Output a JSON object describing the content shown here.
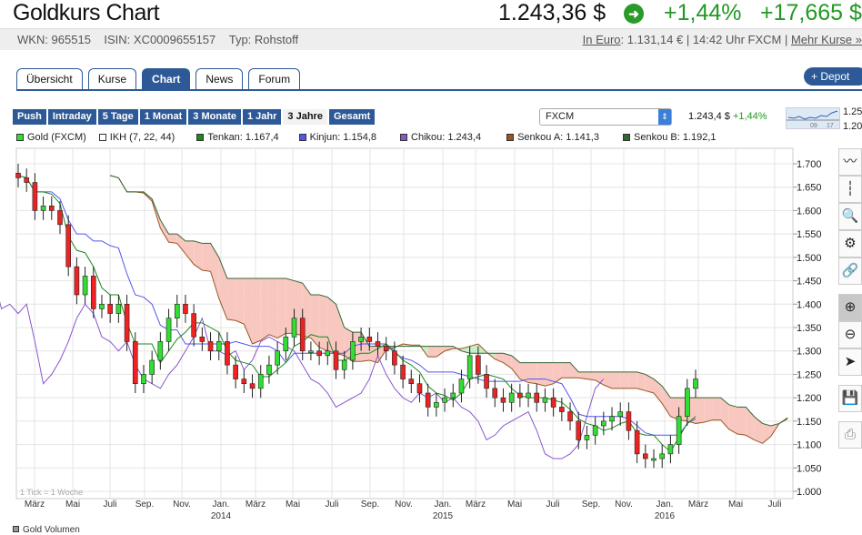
{
  "header": {
    "title": "Goldkurs Chart",
    "price": "1.243,36 $",
    "change_pct": "+1,44%",
    "change_abs": "+17,665 $",
    "trend_icon": "arrow-up-circle-icon"
  },
  "info": {
    "wkn": "WKN: 965515",
    "isin": "ISIN: XC0009655157",
    "typ": "Typ: Rohstoff",
    "euro_label": "In Euro",
    "euro_rest": ": 1.131,14 € | 14:42 Uhr FXCM | ",
    "more": "Mehr Kurse »"
  },
  "tabs": [
    "Übersicht",
    "Kurse",
    "Chart",
    "News",
    "Forum"
  ],
  "depot_button": "+ Depot",
  "periods": [
    "Push",
    "Intraday",
    "5 Tage",
    "1 Monat",
    "3 Monate",
    "1 Jahr",
    "3 Jahre",
    "Gesamt"
  ],
  "exchange": {
    "selected": "FXCM"
  },
  "quote": {
    "price": "1.243,4 $",
    "pct": "+1,44%"
  },
  "spark": {
    "hi": "1.25",
    "lo": "1.20",
    "t1": "09",
    "t2": "17"
  },
  "legend": [
    {
      "label": "Gold (FXCM)",
      "color": "#33dd33"
    },
    {
      "label": "IKH (7, 22, 44)",
      "color": "#ffffff"
    },
    {
      "label": "Tenkan: 1.167,4",
      "color": "#1a8a1a"
    },
    {
      "label": "Kinjun: 1.154,8",
      "color": "#5555ee"
    },
    {
      "label": "Chikou: 1.243,4",
      "color": "#8855cc"
    },
    {
      "label": "Senkou A: 1.141,3",
      "color": "#995522"
    },
    {
      "label": "Senkou B: 1.192,1",
      "color": "#336633"
    }
  ],
  "chart_note": "1 Tick = 1 Woche",
  "volume_label": "Gold Volumen",
  "toolbar": [
    "line-chart-icon",
    "candle-chart-icon",
    "zoom-chart-icon",
    "settings-icon",
    "link-icon",
    "zoom-in-icon",
    "zoom-out-icon",
    "pointer-icon",
    "save-icon",
    "print-icon"
  ],
  "chart_data": {
    "type": "candlestick",
    "interval": "2 weeks per sample",
    "ylim": [
      1.0,
      1.7
    ],
    "yticks": [
      "1.000",
      "1.050",
      "1.100",
      "1.150",
      "1.200",
      "1.250",
      "1.300",
      "1.350",
      "1.400",
      "1.450",
      "1.500",
      "1.550",
      "1.600",
      "1.650",
      "1.700"
    ],
    "xticks": [
      {
        "label": "März",
        "year": ""
      },
      {
        "label": "Mai",
        "year": ""
      },
      {
        "label": "Juli",
        "year": ""
      },
      {
        "label": "Sep.",
        "year": ""
      },
      {
        "label": "Nov.",
        "year": ""
      },
      {
        "label": "Jan.",
        "year": "2014"
      },
      {
        "label": "März",
        "year": ""
      },
      {
        "label": "Mai",
        "year": ""
      },
      {
        "label": "Juli",
        "year": ""
      },
      {
        "label": "Sep.",
        "year": ""
      },
      {
        "label": "Nov.",
        "year": ""
      },
      {
        "label": "Jan.",
        "year": "2015"
      },
      {
        "label": "März",
        "year": ""
      },
      {
        "label": "Mai",
        "year": ""
      },
      {
        "label": "Juli",
        "year": ""
      },
      {
        "label": "Sep.",
        "year": ""
      },
      {
        "label": "Nov.",
        "year": ""
      },
      {
        "label": "Jan.",
        "year": "2016"
      },
      {
        "label": "März",
        "year": ""
      },
      {
        "label": "Mai",
        "year": ""
      },
      {
        "label": "Juli",
        "year": ""
      }
    ],
    "closes": [
      1.67,
      1.66,
      1.6,
      1.61,
      1.6,
      1.57,
      1.48,
      1.42,
      1.46,
      1.39,
      1.4,
      1.38,
      1.4,
      1.32,
      1.23,
      1.25,
      1.28,
      1.32,
      1.37,
      1.4,
      1.38,
      1.33,
      1.32,
      1.3,
      1.32,
      1.27,
      1.24,
      1.23,
      1.22,
      1.25,
      1.27,
      1.3,
      1.33,
      1.37,
      1.3,
      1.3,
      1.29,
      1.3,
      1.26,
      1.28,
      1.32,
      1.33,
      1.32,
      1.31,
      1.3,
      1.27,
      1.24,
      1.23,
      1.21,
      1.18,
      1.19,
      1.2,
      1.21,
      1.24,
      1.29,
      1.25,
      1.22,
      1.2,
      1.19,
      1.21,
      1.2,
      1.21,
      1.19,
      1.2,
      1.18,
      1.17,
      1.15,
      1.11,
      1.12,
      1.14,
      1.15,
      1.16,
      1.17,
      1.13,
      1.08,
      1.07,
      1.07,
      1.08,
      1.1,
      1.16,
      1.22,
      1.24
    ],
    "ichimoku": {
      "tenkan": 7,
      "kijun": 22,
      "senkou_b": 44
    }
  }
}
